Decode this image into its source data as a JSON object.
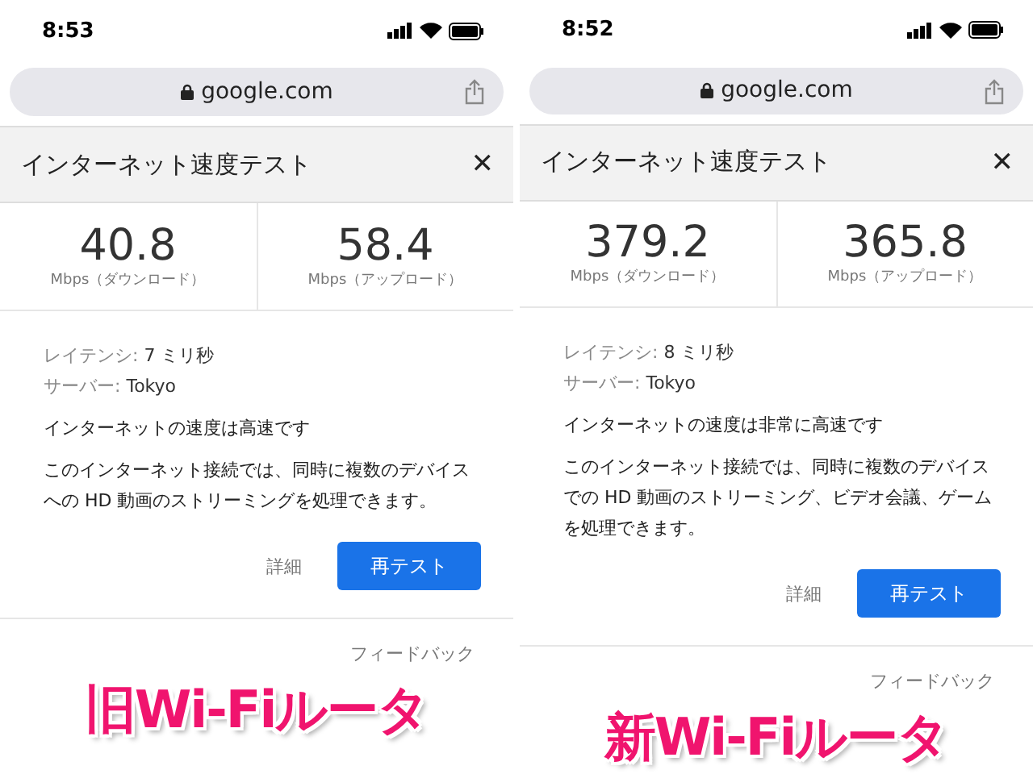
{
  "panels": [
    {
      "status_bar": {
        "time": "8:53"
      },
      "address_bar": {
        "url": "google.com"
      },
      "dialog": {
        "title": "インターネット速度テスト",
        "close": "✕",
        "download": {
          "value": "40.8",
          "unit": "Mbps（ダウンロード）"
        },
        "upload": {
          "value": "58.4",
          "unit": "Mbps（アップロード）"
        },
        "latency": {
          "label": "レイテンシ:",
          "value": "7 ミリ秒"
        },
        "server": {
          "label": "サーバー:",
          "value": "Tokyo"
        },
        "verdict": "インターネットの速度は高速です",
        "description": "このインターネット接続では、同時に複数のデバイスへの HD 動画のストリーミングを処理できます。",
        "details_button": "詳細",
        "retest_button": "再テスト",
        "feedback": "フィードバック"
      },
      "caption": "旧Wi-Fiルータ"
    },
    {
      "status_bar": {
        "time": "8:52"
      },
      "address_bar": {
        "url": "google.com"
      },
      "dialog": {
        "title": "インターネット速度テスト",
        "close": "✕",
        "download": {
          "value": "379.2",
          "unit": "Mbps（ダウンロード）"
        },
        "upload": {
          "value": "365.8",
          "unit": "Mbps（アップロード）"
        },
        "latency": {
          "label": "レイテンシ:",
          "value": "8 ミリ秒"
        },
        "server": {
          "label": "サーバー:",
          "value": "Tokyo"
        },
        "verdict": "インターネットの速度は非常に高速です",
        "description": "このインターネット接続では、同時に複数のデバイスでの HD 動画のストリーミング、ビデオ会議、ゲームを処理できます。",
        "details_button": "詳細",
        "retest_button": "再テスト",
        "feedback": "フィードバック"
      },
      "caption": "新Wi-Fiルータ"
    }
  ]
}
